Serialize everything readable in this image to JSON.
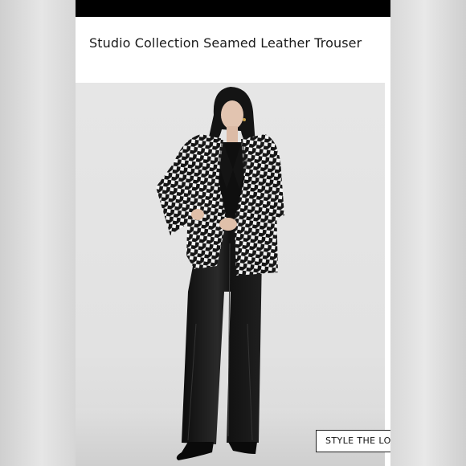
{
  "product": {
    "title": "Studio Collection Seamed Leather Trouser"
  },
  "look_button": {
    "label": "STYLE THE LOOK"
  },
  "colors": {
    "status_bar": "#000000",
    "background": "#ffffff",
    "photo_background": "#e4e4e4",
    "text": "#1a1a1a"
  }
}
